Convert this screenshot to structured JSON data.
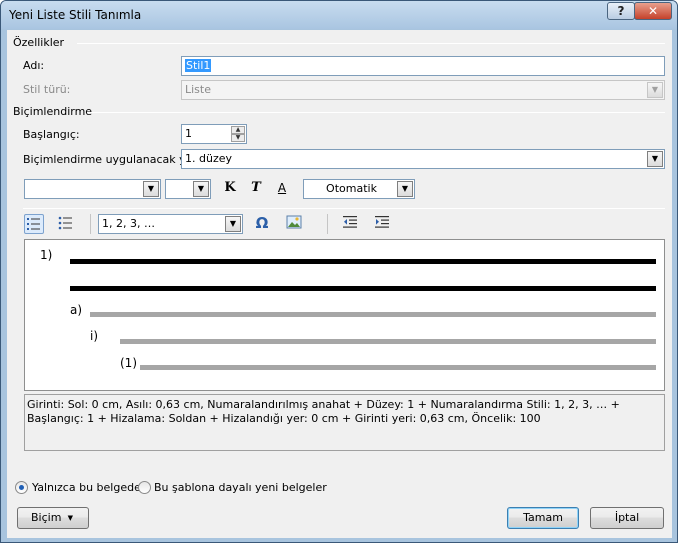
{
  "window": {
    "title": "Yeni Liste Stili Tanımla",
    "help_label": "?",
    "close_label": "✕"
  },
  "properties": {
    "section_label": "Özellikler",
    "name_label": "Adı:",
    "name_value": "Stil1",
    "style_type_label": "Stil türü:",
    "style_type_value": "Liste"
  },
  "formatting": {
    "section_label": "Biçimlendirme",
    "start_label": "Başlangıç:",
    "start_value": "1",
    "apply_to_label": "Biçimlendirme uygulanacak yer:",
    "apply_to_value": "1. düzey",
    "font_name_value": "",
    "font_size_value": "",
    "bold_label": "K",
    "italic_label": "T",
    "font_color_label": "A",
    "color_value": "Otomatik",
    "numbering_value": "1, 2, 3, …",
    "symbol_label": "Ω",
    "dropdown_glyph": "▼"
  },
  "preview": {
    "levels": [
      {
        "marker": "1)",
        "color": "#000000"
      },
      {
        "marker": "a)",
        "color": "#a6a6a6"
      },
      {
        "marker": "i)",
        "color": "#a6a6a6"
      },
      {
        "marker": "(1)",
        "color": "#a6a6a6"
      }
    ]
  },
  "description": "Girinti: Sol:  0 cm, Asılı:  0,63 cm, Numaralandırılmış anahat + Düzey: 1 + Numaralandırma Stili: 1, 2, 3, … + Başlangıç: 1 + Hizalama: Soldan + Hizalandığı yer:  0 cm + Girinti yeri:  0,63 cm, Öncelik: 100",
  "scope": {
    "option_this_document": "Yalnızca bu belgede",
    "option_template": "Bu şablona dayalı yeni belgeler",
    "selected": "this_document"
  },
  "buttons": {
    "format_label": "Biçim",
    "ok_label": "Tamam",
    "cancel_label": "İptal"
  }
}
